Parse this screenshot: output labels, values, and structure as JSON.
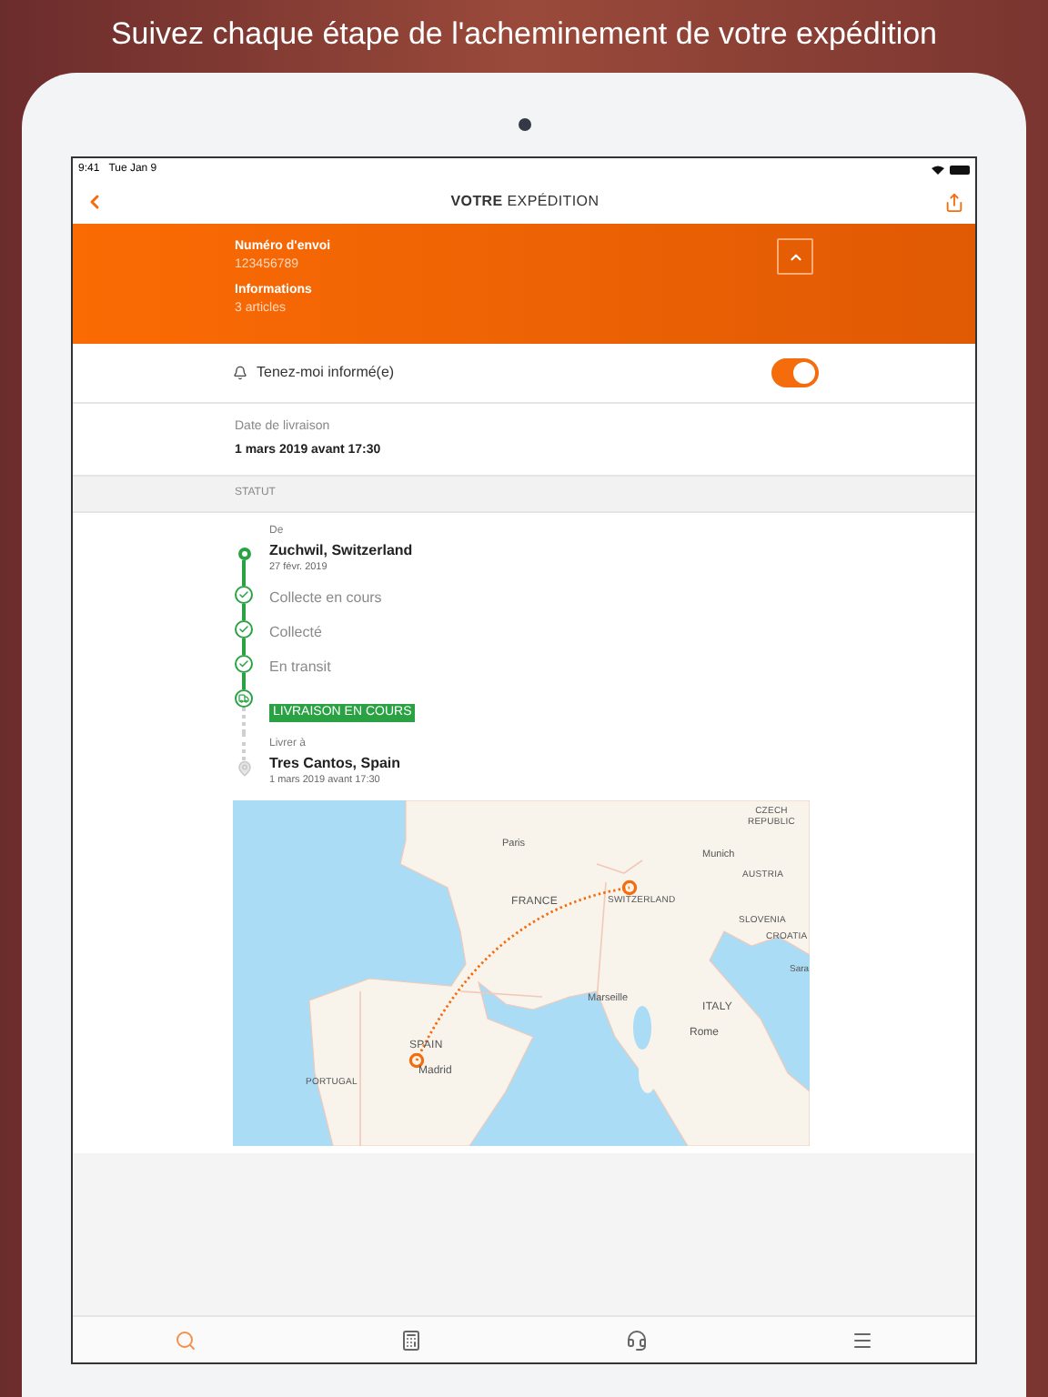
{
  "headline": "Suivez chaque étape de l'acheminement de votre expédition",
  "status_bar": {
    "time": "9:41",
    "date": "Tue Jan 9"
  },
  "nav": {
    "title": "**VOTRE** EXPÉDITION"
  },
  "summary": {
    "expanded": true,
    "fields": [
      {
        "label": "Numéro d'envoi",
        "value": "123456789"
      },
      {
        "label": "Informations",
        "value": "3 articles"
      }
    ]
  },
  "notify": {
    "label": "Tenez-moi informé(e)",
    "on": true
  },
  "delivery": {
    "label": "Date de livraison",
    "value": "1 mars 2019 avant 17:30"
  },
  "section_header": "STATUT",
  "timeline": [
    {
      "kind": "origin",
      "caption": "De",
      "title": "Zuchwil, Switzerland",
      "sub": "27 févr. 2019"
    },
    {
      "kind": "step",
      "title": "Collecte en cours"
    },
    {
      "kind": "step",
      "title": "Collecté"
    },
    {
      "kind": "step",
      "title": "En transit"
    },
    {
      "kind": "current",
      "title": "LIVRAISON EN COURS"
    },
    {
      "kind": "destination",
      "caption": "Livrer à",
      "title": "Tres Cantos, Spain",
      "sub": "1 mars 2019 avant 17:30"
    }
  ],
  "map": {
    "labels": [
      "CZECH REPUBLIC",
      "Paris",
      "Munich",
      "AUSTRIA",
      "FRANCE",
      "SWITZERLAND",
      "SLOVENIA",
      "CROATIA",
      "Sara",
      "Marseille",
      "ITALY",
      "Rome",
      "SPAIN",
      "Madrid",
      "PORTUGAL"
    ]
  },
  "tab_bar": [
    {
      "selected": true
    },
    {
      "selected": false
    },
    {
      "selected": false
    },
    {
      "selected": false
    }
  ]
}
